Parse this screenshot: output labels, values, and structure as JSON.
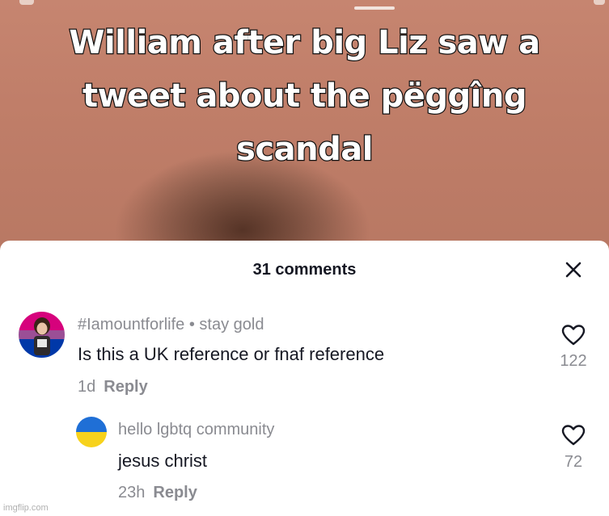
{
  "caption": {
    "line1": "William after big Liz saw a",
    "line2": "tweet about the pëggîng",
    "line3": "scandal"
  },
  "sheet": {
    "title": "31 comments"
  },
  "comments": [
    {
      "username": "#Iamountforlife • stay gold",
      "text": "Is this a UK reference or fnaf reference",
      "time": "1d",
      "reply_label": "Reply",
      "likes": "122"
    },
    {
      "username": "hello lgbtq community",
      "text": "jesus christ",
      "time": "23h",
      "reply_label": "Reply",
      "likes": "72"
    }
  ],
  "watermark": "imgflip.com",
  "colors": {
    "text_primary": "#161823",
    "text_secondary": "#8a8b91",
    "sheet_bg": "#ffffff",
    "video_bg": "#c07e69"
  },
  "icons": {
    "close": "close-icon",
    "like": "heart-outline-icon"
  }
}
